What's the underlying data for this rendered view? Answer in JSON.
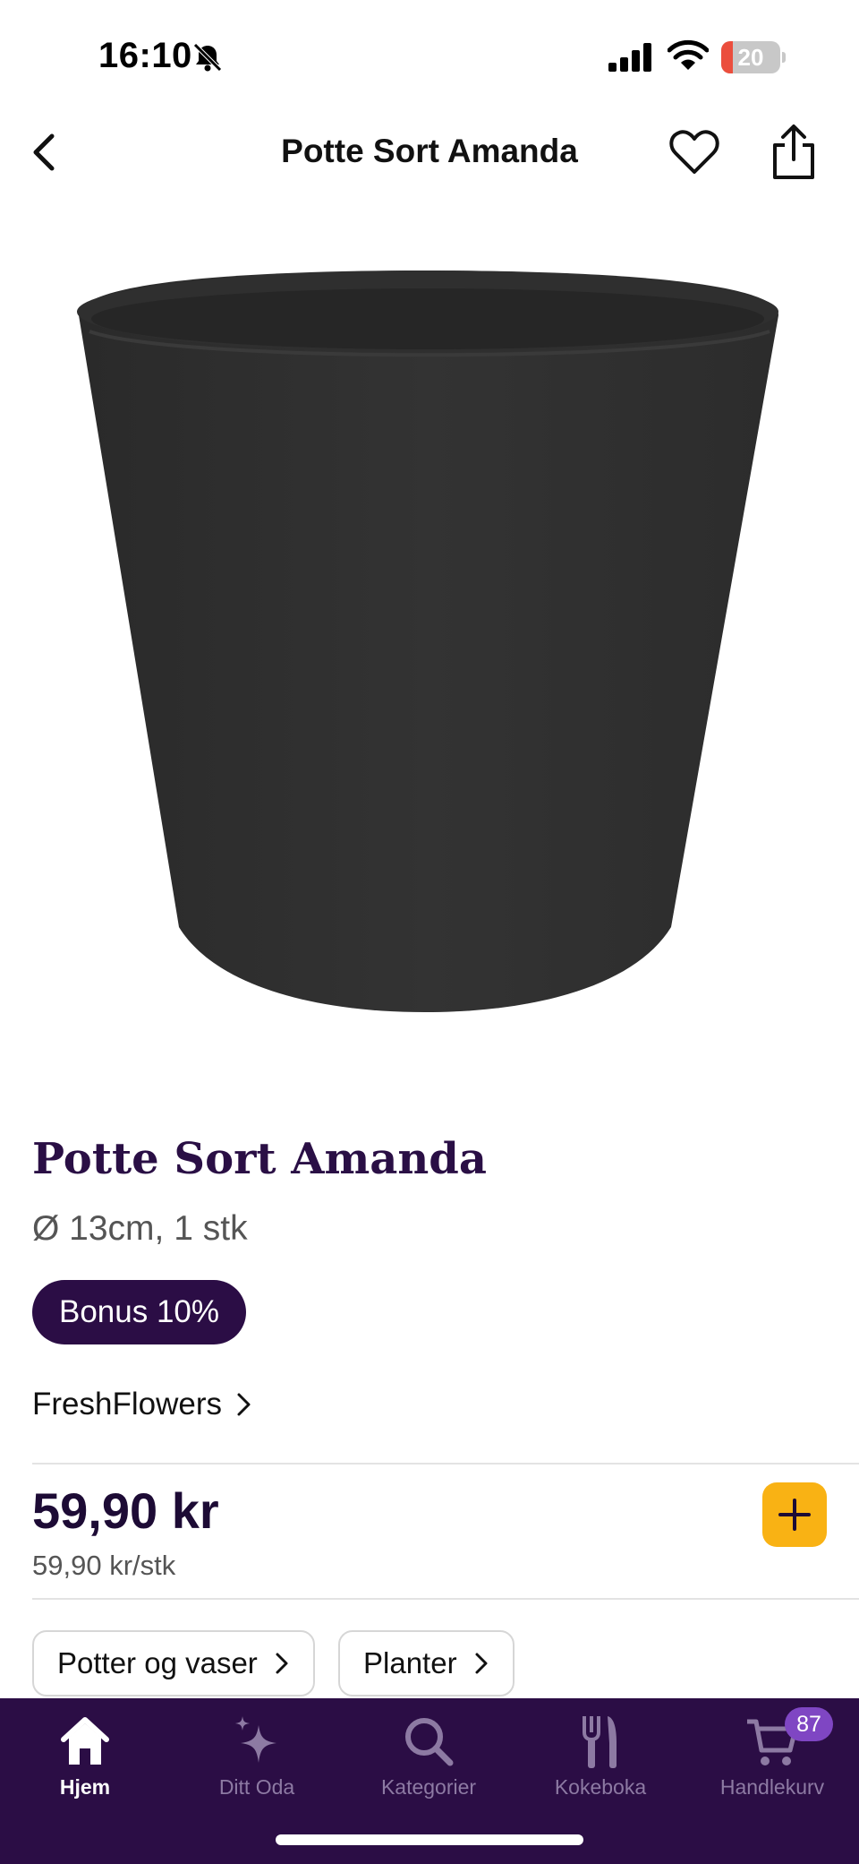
{
  "status_bar": {
    "time": "16:10",
    "battery_level": "20",
    "battery_fraction": 0.2,
    "silent_icon": "bell-slash-icon",
    "signal_icon": "cellular-signal-icon",
    "wifi_icon": "wifi-icon"
  },
  "nav": {
    "title": "Potte Sort Amanda",
    "back_icon": "chevron-left-icon",
    "favorite_icon": "heart-icon",
    "share_icon": "share-icon"
  },
  "product": {
    "name": "Potte Sort Amanda",
    "description": "Ø 13cm, 1 stk",
    "badge": "Bonus 10%",
    "brand": "FreshFlowers",
    "price": "59,90 kr",
    "unit_price": "59,90 kr/stk",
    "add_icon": "plus-icon"
  },
  "categories": [
    {
      "label": "Potter og vaser"
    },
    {
      "label": "Planter"
    }
  ],
  "tab_bar": {
    "tabs": [
      {
        "label": "Hjem",
        "icon": "home-icon",
        "active": true
      },
      {
        "label": "Ditt Oda",
        "icon": "sparkle-icon",
        "active": false
      },
      {
        "label": "Kategorier",
        "icon": "search-icon",
        "active": false
      },
      {
        "label": "Kokeboka",
        "icon": "fork-knife-icon",
        "active": false
      },
      {
        "label": "Handlekurv",
        "icon": "cart-icon",
        "active": false
      }
    ],
    "cart_count": "87"
  },
  "colors": {
    "brand_purple": "#2b0d45",
    "accent_yellow": "#f9b214",
    "badge_purple": "#7f46c3",
    "battery_red": "#eb4e3d"
  }
}
